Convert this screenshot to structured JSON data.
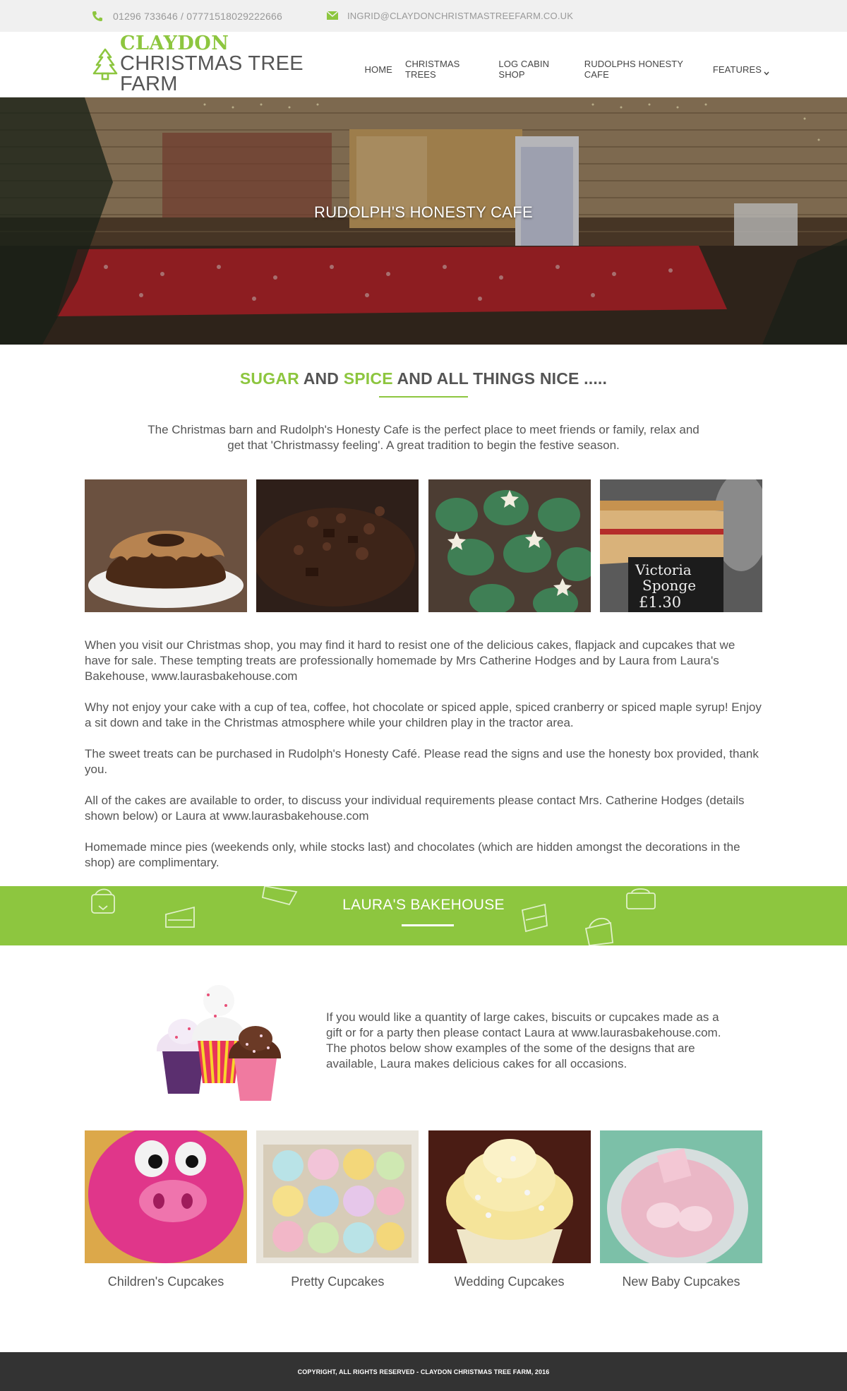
{
  "topbar": {
    "phone_icon": "phone-icon",
    "phone": "01296 733646 / 07771518029222666",
    "email_icon": "envelope-icon",
    "email": "ingrid@claydonchristmastreefarm.co.uk"
  },
  "logo": {
    "icon": "christmas-tree-icon",
    "line1": "CLAYDON",
    "line2": "CHRISTMAS TREE FARM"
  },
  "nav": {
    "items": [
      "HOME",
      "CHRISTMAS TREES",
      "LOG CABIN SHOP",
      "RUDOLPHS HONESTY CAFE",
      "FEATURES"
    ],
    "dropdown_icon": "chevron-down-icon"
  },
  "hero": {
    "title": "RUDOLPH'S HONESTY CAFE"
  },
  "intro_section": {
    "heading_word1": "SUGAR",
    "heading_and1": " AND ",
    "heading_word2": "SPICE",
    "heading_rest": " AND ALL THINGS NICE .....",
    "text": "The Christmas barn and Rudolph's Honesty Cafe is the perfect place to meet friends or family, relax and get that 'Christmassy feeling'.  A great tradition to begin the festive season."
  },
  "gallery": {
    "photos": [
      "caramel bundt cake",
      "chocolate cake",
      "christmas tree cupcakes",
      "victoria sponge cake"
    ],
    "sign_line1": "Victoria",
    "sign_line2": "Sponge",
    "sign_line3": "£1.30"
  },
  "content": {
    "p1": "When you visit our Christmas shop, you may find it hard to resist one of the delicious cakes, flapjack and cupcakes that we have for sale.  These tempting treats are professionally homemade by Mrs Catherine Hodges and by Laura from Laura's Bakehouse, www.laurasbakehouse.com",
    "p2": "Why not enjoy your cake with a cup of tea, coffee, hot chocolate or spiced apple, spiced cranberry or spiced maple syrup!  Enjoy a sit down and take in the Christmas atmosphere while your children play in the tractor area.",
    "p3": "The sweet treats can be purchased in Rudolph's Honesty Café.  Please read the signs and use the honesty box provided, thank you.",
    "p4": "All of the cakes are available to order, to discuss your individual requirements please contact Mrs. Catherine Hodges (details shown below) or Laura at www.laurasbakehouse.com",
    "p5": "Homemade mince pies (weekends only, while stocks last) and chocolates (which are hidden amongst the decorations in the shop) are complimentary."
  },
  "bakehouse": {
    "title": "LAURA'S BAKEHOUSE",
    "text": "If you would like a quantity of large cakes, biscuits or cupcakes made as a gift or for a party then please contact Laura at www.laurasbakehouse.com. The photos below show examples of the some of the designs that are available, Laura makes delicious cakes for all occasions.",
    "items": [
      "Children's Cupcakes",
      "Pretty Cupcakes",
      "Wedding Cupcakes",
      "New Baby Cupcakes"
    ]
  },
  "footer": {
    "text": "COPYRIGHT, ALL RIGHTS RESERVED - CLAYDON CHRISTMAS TREE FARM, 2016"
  },
  "colors": {
    "accent": "#8dc63f",
    "text": "#555555",
    "topbar_bg": "#f0f0f0",
    "footer_bg": "#333333"
  }
}
